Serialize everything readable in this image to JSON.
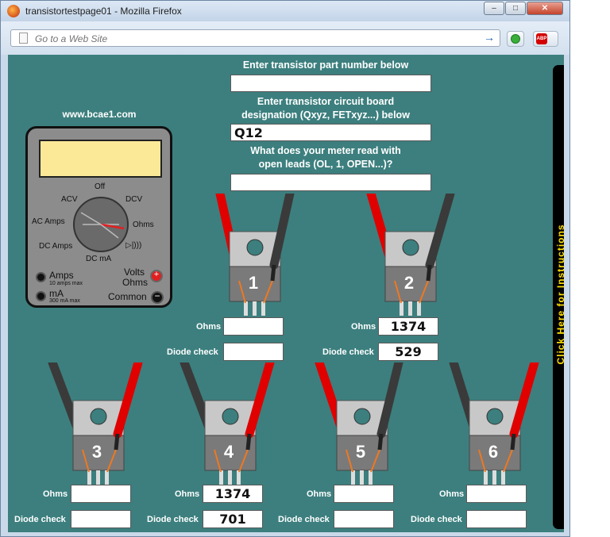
{
  "window": {
    "title": "transistortestpage01 - Mozilla Firefox",
    "minimize": "–",
    "maximize": "□",
    "close": "✕"
  },
  "navbar": {
    "address_placeholder": "Go to a Web Site",
    "go": "→"
  },
  "page": {
    "part_number_label": "Enter transistor part number below",
    "part_number_value": "",
    "designation_label_1": "Enter transistor circuit board",
    "designation_label_2": "designation (Qxyz, FETxyz...) below",
    "designation_value": "Q12",
    "open_leads_label_1": "What does your meter read with",
    "open_leads_label_2": "open leads (OL, 1, OPEN...)?",
    "open_leads_value": "",
    "instructions": "Click Here for Instructions"
  },
  "meter": {
    "site": "www.bcae1.com",
    "labels": {
      "off": "Off",
      "acv": "ACV",
      "dcv": "DCV",
      "ac_amps": "AC Amps",
      "ohms": "Ohms",
      "dc_amps": "DC Amps",
      "dc_ma": "DC mA",
      "diode": "▷|)))"
    },
    "jacks": {
      "amps": "Amps",
      "amps_note": "10 amps max",
      "ma": "mA",
      "ma_note": "300 mA max",
      "volts": "Volts",
      "ohms": "Ohms",
      "common": "Common",
      "plus": "+",
      "minus": "−"
    },
    "pointer": "ohms"
  },
  "row_labels": {
    "ohms": "Ohms",
    "diode": "Diode check"
  },
  "transistors": [
    {
      "number": "1",
      "ohms": "",
      "diode": ""
    },
    {
      "number": "2",
      "ohms": "1374",
      "diode": "529"
    },
    {
      "number": "3",
      "ohms": "",
      "diode": ""
    },
    {
      "number": "4",
      "ohms": "1374",
      "diode": "701"
    },
    {
      "number": "5",
      "ohms": "",
      "diode": ""
    },
    {
      "number": "6",
      "ohms": "",
      "diode": ""
    }
  ],
  "colors": {
    "background": "#3c7f7e",
    "probe_red": "#e00000",
    "probe_black": "#3a3a3a",
    "instructions_text": "#ffe000",
    "lcd": "#fbe998"
  }
}
